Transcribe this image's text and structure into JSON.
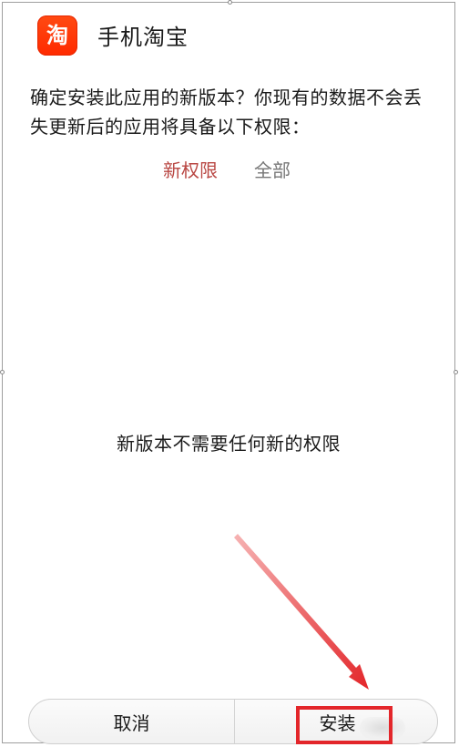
{
  "app": {
    "name": "手机淘宝",
    "icon": "taobao-app-icon",
    "icon_glyph": "淘",
    "icon_color": "#ff3300"
  },
  "dialog": {
    "message": "确定安装此应用的新版本？你现有的数据不会丢失更新后的应用将具备以下权限："
  },
  "tabs": [
    {
      "label": "新权限",
      "active": true
    },
    {
      "label": "全部",
      "active": false
    }
  ],
  "content": {
    "message": "新版本不需要任何新的权限"
  },
  "buttons": {
    "cancel_label": "取消",
    "install_label": "安装"
  },
  "annotation": {
    "color": "#e3262a"
  }
}
